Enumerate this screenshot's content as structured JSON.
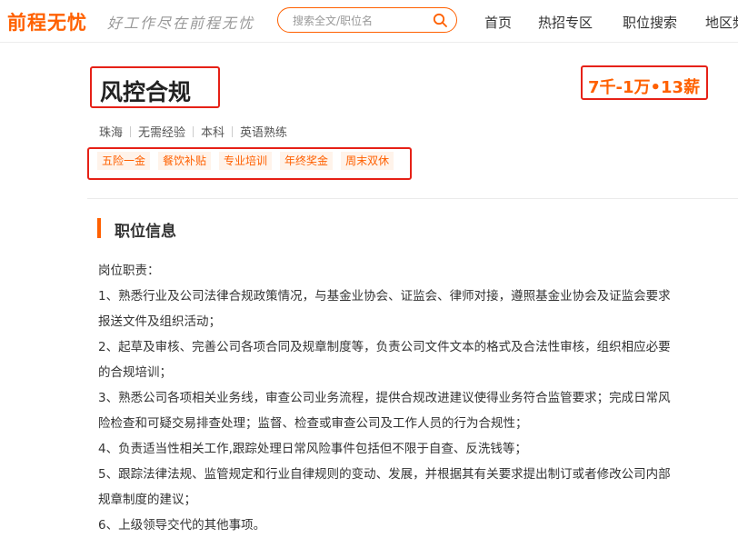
{
  "header": {
    "logo": "前程无忧",
    "slogan": "好工作尽在前程无忧",
    "search_placeholder": "搜索全文/职位名",
    "nav": [
      "首页",
      "热招专区",
      "职位搜索",
      "地区频"
    ]
  },
  "job": {
    "title": "风控合规",
    "salary": "7千-1万•13薪",
    "meta": [
      "珠海",
      "无需经验",
      "本科",
      "英语熟练"
    ],
    "benefits": [
      "五险一金",
      "餐饮补贴",
      "专业培训",
      "年终奖金",
      "周末双休"
    ]
  },
  "section": {
    "title": "职位信息",
    "lines": [
      "岗位职责：",
      "1、熟悉行业及公司法律合规政策情况，与基金业协会、证监会、律师对接，遵照基金业协会及证监会要求",
      "报送文件及组织活动；",
      "2、起草及审核、完善公司各项合同及规章制度等，负责公司文件文本的格式及合法性审核，组织相应必要",
      "的合规培训；",
      "3、熟悉公司各项相关业务线，审查公司业务流程，提供合规改进建议使得业务符合监管要求；完成日常风",
      "险检查和可疑交易排查处理；监督、检查或审查公司及工作人员的行为合规性；",
      "4、负责适当性相关工作,跟踪处理日常风险事件包括但不限于自查、反洗钱等；",
      "5、跟踪法律法规、监管规定和行业自律规则的变动、发展，并根据其有关要求提出制订或者修改公司内部",
      "规章制度的建议；",
      "6、上级领导交代的其他事项。"
    ]
  },
  "colors": {
    "brand": "#ff6000",
    "highlight_box": "#e62117"
  }
}
